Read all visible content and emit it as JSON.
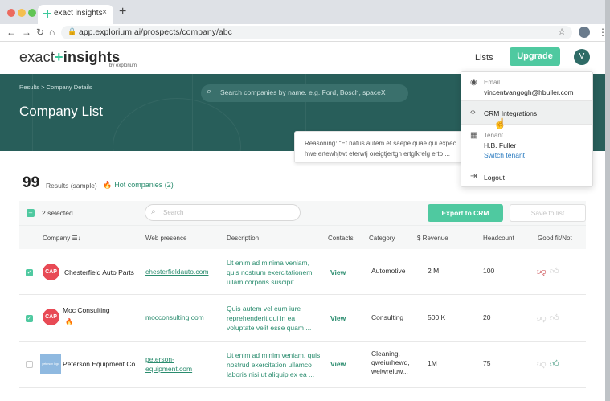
{
  "browser": {
    "tab_title": "exact insights",
    "tab_close": "×",
    "new_tab": "+",
    "url": "app.explorium.ai/prospects/company/abc",
    "traffic_colors": [
      "#ec6a5e",
      "#f4bf4f",
      "#61c554"
    ]
  },
  "header": {
    "logo_text_a": "exact",
    "logo_plus": "+",
    "logo_text_b": "insights",
    "logo_sub": "by explorium",
    "lists": "Lists",
    "upgrade": "Upgrade",
    "avatar_initial": "V"
  },
  "hero": {
    "breadcrumb": "Results  >  Company Details",
    "search_placeholder": "Search companies by name. e.g. Ford, Bosch, spaceX",
    "title": "Company List"
  },
  "reasoning": {
    "line1": "Reasoning: “Et natus autem et saepe quae qui expec",
    "line2": "hwe ertewhjtwt eterwtj  oreigtjertgn ertglkrelg erto ..."
  },
  "summary": {
    "count": "99",
    "count_label": "Results (sample)",
    "hot_label": "Hot companies (2)"
  },
  "toolbar": {
    "selected": "2 selected",
    "search_placeholder": "Search",
    "export": "Export to CRM",
    "save": "Save to list"
  },
  "table": {
    "headers": [
      "Company ☰↓",
      "Web presence",
      "Description",
      "Contacts",
      "Category",
      "$ Revenue",
      "Headcount",
      "Good fit/Not"
    ],
    "rows": [
      {
        "checked": true,
        "logo": "CAP",
        "name": "Chesterfield Auto Parts",
        "web": "chesterfieldauto.com",
        "desc": "Ut enim ad minima veniam, quis nostrum exercitationem ullam corporis suscipit ...",
        "contacts": "View",
        "category": "Automotive",
        "revenue": "2 M",
        "headcount": "100",
        "fit": "down"
      },
      {
        "checked": true,
        "logo": "CAP",
        "name": "Moc Consulting",
        "web": "mocconsulting.com",
        "desc": "Quis autem vel eum iure reprehenderit qui in ea voluptate velit esse quam ...",
        "contacts": "View",
        "category": "Consulting",
        "revenue": "500 K",
        "headcount": "20",
        "fit": "none"
      },
      {
        "checked": false,
        "logo": "peterson logo",
        "name": "Peterson Equipment Co.",
        "web": "peterson-equipment.com",
        "desc": "Ut enim ad minim veniam, quis nostrud exercitation ullamco laboris nisi ut aliquip ex ea ...",
        "contacts": "View",
        "category": "Cleaning, qweiurhewq, weiwreiuw...",
        "revenue": "1M",
        "headcount": "75",
        "fit": "up"
      }
    ]
  },
  "dropdown": {
    "email_label": "Email",
    "email": "vincentvangogh@hbuller.com",
    "crm": "CRM Integrations",
    "tenant_label": "Tenant",
    "tenant": "H.B. Fuller",
    "switch": "Switch tenant",
    "logout": "Logout"
  },
  "colors": {
    "accent": "#4fc9a0",
    "hero": "#285e5a",
    "link": "#2a8c6e",
    "thumb_down": "#c0282d",
    "thumb_up": "#2a8c6e"
  }
}
